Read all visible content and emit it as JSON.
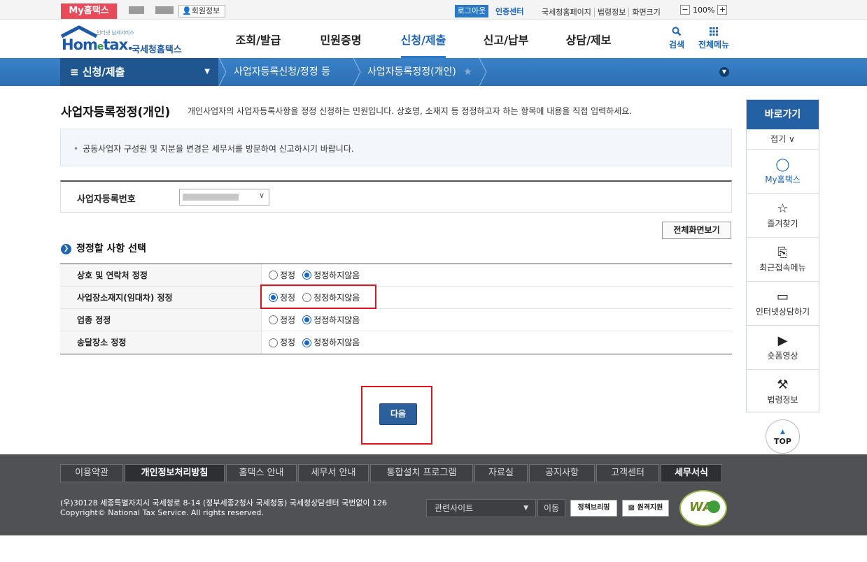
{
  "util": {
    "myhome": "My홈택스",
    "member": "회원정보",
    "logout": "로그아웃",
    "cert": "인증센터",
    "links": [
      "국세청홈페이지",
      "법령정보",
      "화면크기"
    ],
    "zoom_minus": "−",
    "zoom_value": "100%",
    "zoom_plus": "+"
  },
  "header": {
    "logo_sub": "인터넷 납세서비스",
    "logo_main": "Hom",
    "logo_e": "e",
    "logo_tax": "tax.",
    "logo_kr": "국세청홈택스",
    "menu": [
      "조회/발급",
      "민원증명",
      "신청/제출",
      "신고/납부",
      "상담/제보"
    ],
    "search": "검색",
    "allmenu": "전체메뉴"
  },
  "location": {
    "first": "≡  신청/제출",
    "second": "사업자등록신청/정정 등",
    "third": "사업자등록정정(개인)"
  },
  "main": {
    "title": "사업자등록정정(개인)",
    "desc": "개인사업자의 사업자등록사항을 정정 신청하는 민원입니다. 상호명, 소재지 등 정정하고자 하는 항목에 내용을 직접 입력하세요.",
    "notice": "공동사업자 구성원 및 지분을 변경은 세무서를 방문하여 신고하시기 바랍니다.",
    "bizno_label": "사업자등록번호",
    "full_view": "전체화면보기",
    "section": "정정할 사항 선택",
    "opt_on": "정정",
    "opt_off": "정정하지않음",
    "rows": [
      {
        "label": "상호 및 연락처 정정",
        "selected": "정정하지않음"
      },
      {
        "label": "사업장소재지(임대차) 정정",
        "selected": "정정"
      },
      {
        "label": "업종 정정",
        "selected": "정정하지않음"
      },
      {
        "label": "송달장소 정정",
        "selected": "정정하지않음"
      }
    ],
    "next": "다음"
  },
  "quick": {
    "title": "바로가기",
    "fold": "접기 ∨",
    "items": [
      {
        "label": "My홈택스",
        "icon": "user-icon"
      },
      {
        "label": "즐겨찾기",
        "icon": "star-icon"
      },
      {
        "label": "최근접속메뉴",
        "icon": "recent-icon"
      },
      {
        "label": "인터넷상담하기",
        "icon": "laptop-icon"
      },
      {
        "label": "숏폼영상",
        "icon": "play-icon"
      },
      {
        "label": "법령정보",
        "icon": "gavel-icon"
      }
    ],
    "top": "TOP"
  },
  "footer": {
    "links": [
      "이용약관",
      "개인정보처리방침",
      "홈택스 안내",
      "세무서 안내",
      "통합설치 프로그램",
      "자료실",
      "공지사항",
      "고객센터",
      "세무서식"
    ],
    "address": "(우)30128 세종특별자치시 국세청로 8-14 (정부세종2청사 국세청동) 국세청상담센터 국번없이 126",
    "copyright": "Copyright© National Tax Service. All rights reserved.",
    "related": "관련사이트",
    "go": "이동",
    "badge1": "정책브리핑",
    "badge2": "원격지원",
    "wa": "WA"
  }
}
